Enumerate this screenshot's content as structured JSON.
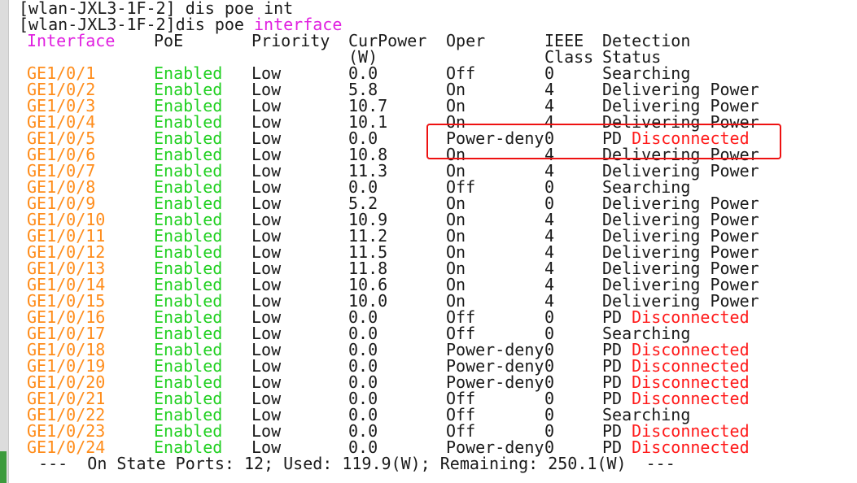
{
  "terminal": {
    "prompt_line_1": "[wlan-JXL3-1F-2] dis poe int",
    "prompt_line_2_prefix": "[wlan-JXL3-1F-2]dis poe ",
    "prompt_line_2_keyword": "interface",
    "headers": {
      "interface": "Interface",
      "poe": "PoE",
      "priority": "Priority",
      "curpower": "CurPower",
      "curpower_unit": "(W)",
      "oper": "Oper",
      "ieee": "IEEE",
      "class": "Class",
      "detection": "Detection",
      "status": "Status"
    },
    "rows": [
      {
        "iface": "GE1/0/1",
        "poe": "Enabled",
        "priority": "Low",
        "power": "0.0",
        "oper": "Off",
        "class": "0",
        "det_prefix": "Searching",
        "det_suffix": ""
      },
      {
        "iface": "GE1/0/2",
        "poe": "Enabled",
        "priority": "Low",
        "power": "5.8",
        "oper": "On",
        "class": "4",
        "det_prefix": "Delivering Power",
        "det_suffix": ""
      },
      {
        "iface": "GE1/0/3",
        "poe": "Enabled",
        "priority": "Low",
        "power": "10.7",
        "oper": "On",
        "class": "4",
        "det_prefix": "Delivering Power",
        "det_suffix": ""
      },
      {
        "iface": "GE1/0/4",
        "poe": "Enabled",
        "priority": "Low",
        "power": "10.1",
        "oper": "On",
        "class": "4",
        "det_prefix": "Delivering Power",
        "det_suffix": ""
      },
      {
        "iface": "GE1/0/5",
        "poe": "Enabled",
        "priority": "Low",
        "power": "0.0",
        "oper": "Power-deny",
        "class": "0",
        "det_prefix": "PD ",
        "det_suffix": "Disconnected"
      },
      {
        "iface": "GE1/0/6",
        "poe": "Enabled",
        "priority": "Low",
        "power": "10.8",
        "oper": "On",
        "class": "4",
        "det_prefix": "Delivering Power",
        "det_suffix": ""
      },
      {
        "iface": "GE1/0/7",
        "poe": "Enabled",
        "priority": "Low",
        "power": "11.3",
        "oper": "On",
        "class": "4",
        "det_prefix": "Delivering Power",
        "det_suffix": ""
      },
      {
        "iface": "GE1/0/8",
        "poe": "Enabled",
        "priority": "Low",
        "power": "0.0",
        "oper": "Off",
        "class": "0",
        "det_prefix": "Searching",
        "det_suffix": ""
      },
      {
        "iface": "GE1/0/9",
        "poe": "Enabled",
        "priority": "Low",
        "power": "5.2",
        "oper": "On",
        "class": "0",
        "det_prefix": "Delivering Power",
        "det_suffix": ""
      },
      {
        "iface": "GE1/0/10",
        "poe": "Enabled",
        "priority": "Low",
        "power": "10.9",
        "oper": "On",
        "class": "4",
        "det_prefix": "Delivering Power",
        "det_suffix": ""
      },
      {
        "iface": "GE1/0/11",
        "poe": "Enabled",
        "priority": "Low",
        "power": "11.2",
        "oper": "On",
        "class": "4",
        "det_prefix": "Delivering Power",
        "det_suffix": ""
      },
      {
        "iface": "GE1/0/12",
        "poe": "Enabled",
        "priority": "Low",
        "power": "11.5",
        "oper": "On",
        "class": "4",
        "det_prefix": "Delivering Power",
        "det_suffix": ""
      },
      {
        "iface": "GE1/0/13",
        "poe": "Enabled",
        "priority": "Low",
        "power": "11.8",
        "oper": "On",
        "class": "4",
        "det_prefix": "Delivering Power",
        "det_suffix": ""
      },
      {
        "iface": "GE1/0/14",
        "poe": "Enabled",
        "priority": "Low",
        "power": "10.6",
        "oper": "On",
        "class": "4",
        "det_prefix": "Delivering Power",
        "det_suffix": ""
      },
      {
        "iface": "GE1/0/15",
        "poe": "Enabled",
        "priority": "Low",
        "power": "10.0",
        "oper": "On",
        "class": "4",
        "det_prefix": "Delivering Power",
        "det_suffix": ""
      },
      {
        "iface": "GE1/0/16",
        "poe": "Enabled",
        "priority": "Low",
        "power": "0.0",
        "oper": "Off",
        "class": "0",
        "det_prefix": "PD ",
        "det_suffix": "Disconnected"
      },
      {
        "iface": "GE1/0/17",
        "poe": "Enabled",
        "priority": "Low",
        "power": "0.0",
        "oper": "Off",
        "class": "0",
        "det_prefix": "Searching",
        "det_suffix": ""
      },
      {
        "iface": "GE1/0/18",
        "poe": "Enabled",
        "priority": "Low",
        "power": "0.0",
        "oper": "Power-deny",
        "class": "0",
        "det_prefix": "PD ",
        "det_suffix": "Disconnected"
      },
      {
        "iface": "GE1/0/19",
        "poe": "Enabled",
        "priority": "Low",
        "power": "0.0",
        "oper": "Power-deny",
        "class": "0",
        "det_prefix": "PD ",
        "det_suffix": "Disconnected"
      },
      {
        "iface": "GE1/0/20",
        "poe": "Enabled",
        "priority": "Low",
        "power": "0.0",
        "oper": "Power-deny",
        "class": "0",
        "det_prefix": "PD ",
        "det_suffix": "Disconnected"
      },
      {
        "iface": "GE1/0/21",
        "poe": "Enabled",
        "priority": "Low",
        "power": "0.0",
        "oper": "Off",
        "class": "0",
        "det_prefix": "PD ",
        "det_suffix": "Disconnected"
      },
      {
        "iface": "GE1/0/22",
        "poe": "Enabled",
        "priority": "Low",
        "power": "0.0",
        "oper": "Off",
        "class": "0",
        "det_prefix": "Searching",
        "det_suffix": ""
      },
      {
        "iface": "GE1/0/23",
        "poe": "Enabled",
        "priority": "Low",
        "power": "0.0",
        "oper": "Off",
        "class": "0",
        "det_prefix": "PD ",
        "det_suffix": "Disconnected"
      },
      {
        "iface": "GE1/0/24",
        "poe": "Enabled",
        "priority": "Low",
        "power": "0.0",
        "oper": "Power-deny",
        "class": "0",
        "det_prefix": "PD ",
        "det_suffix": "Disconnected"
      }
    ],
    "summary": "  ---  On State Ports: 12; Used: 119.9(W); Remaining: 250.1(W)  ---"
  },
  "colors": {
    "keyword": "#e020e0",
    "interface": "#ff8c1a",
    "enabled": "#22d022",
    "disconnected": "#ff1a1a",
    "highlight": "#ee1111"
  }
}
